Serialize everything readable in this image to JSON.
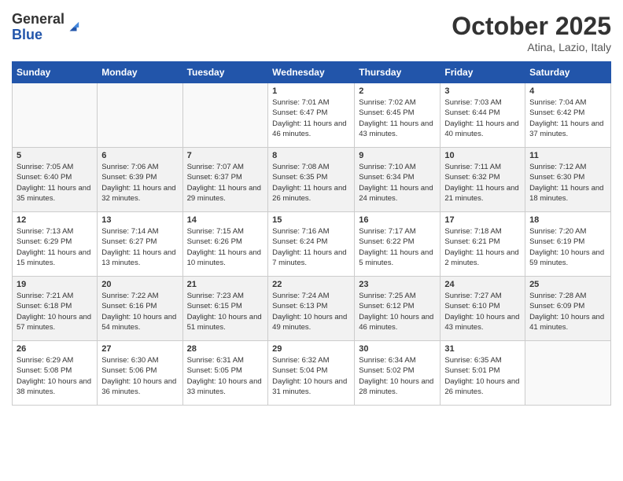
{
  "header": {
    "logo_general": "General",
    "logo_blue": "Blue",
    "month": "October 2025",
    "location": "Atina, Lazio, Italy"
  },
  "days_of_week": [
    "Sunday",
    "Monday",
    "Tuesday",
    "Wednesday",
    "Thursday",
    "Friday",
    "Saturday"
  ],
  "weeks": [
    [
      {
        "day": "",
        "info": ""
      },
      {
        "day": "",
        "info": ""
      },
      {
        "day": "",
        "info": ""
      },
      {
        "day": "1",
        "info": "Sunrise: 7:01 AM\nSunset: 6:47 PM\nDaylight: 11 hours and 46 minutes."
      },
      {
        "day": "2",
        "info": "Sunrise: 7:02 AM\nSunset: 6:45 PM\nDaylight: 11 hours and 43 minutes."
      },
      {
        "day": "3",
        "info": "Sunrise: 7:03 AM\nSunset: 6:44 PM\nDaylight: 11 hours and 40 minutes."
      },
      {
        "day": "4",
        "info": "Sunrise: 7:04 AM\nSunset: 6:42 PM\nDaylight: 11 hours and 37 minutes."
      }
    ],
    [
      {
        "day": "5",
        "info": "Sunrise: 7:05 AM\nSunset: 6:40 PM\nDaylight: 11 hours and 35 minutes."
      },
      {
        "day": "6",
        "info": "Sunrise: 7:06 AM\nSunset: 6:39 PM\nDaylight: 11 hours and 32 minutes."
      },
      {
        "day": "7",
        "info": "Sunrise: 7:07 AM\nSunset: 6:37 PM\nDaylight: 11 hours and 29 minutes."
      },
      {
        "day": "8",
        "info": "Sunrise: 7:08 AM\nSunset: 6:35 PM\nDaylight: 11 hours and 26 minutes."
      },
      {
        "day": "9",
        "info": "Sunrise: 7:10 AM\nSunset: 6:34 PM\nDaylight: 11 hours and 24 minutes."
      },
      {
        "day": "10",
        "info": "Sunrise: 7:11 AM\nSunset: 6:32 PM\nDaylight: 11 hours and 21 minutes."
      },
      {
        "day": "11",
        "info": "Sunrise: 7:12 AM\nSunset: 6:30 PM\nDaylight: 11 hours and 18 minutes."
      }
    ],
    [
      {
        "day": "12",
        "info": "Sunrise: 7:13 AM\nSunset: 6:29 PM\nDaylight: 11 hours and 15 minutes."
      },
      {
        "day": "13",
        "info": "Sunrise: 7:14 AM\nSunset: 6:27 PM\nDaylight: 11 hours and 13 minutes."
      },
      {
        "day": "14",
        "info": "Sunrise: 7:15 AM\nSunset: 6:26 PM\nDaylight: 11 hours and 10 minutes."
      },
      {
        "day": "15",
        "info": "Sunrise: 7:16 AM\nSunset: 6:24 PM\nDaylight: 11 hours and 7 minutes."
      },
      {
        "day": "16",
        "info": "Sunrise: 7:17 AM\nSunset: 6:22 PM\nDaylight: 11 hours and 5 minutes."
      },
      {
        "day": "17",
        "info": "Sunrise: 7:18 AM\nSunset: 6:21 PM\nDaylight: 11 hours and 2 minutes."
      },
      {
        "day": "18",
        "info": "Sunrise: 7:20 AM\nSunset: 6:19 PM\nDaylight: 10 hours and 59 minutes."
      }
    ],
    [
      {
        "day": "19",
        "info": "Sunrise: 7:21 AM\nSunset: 6:18 PM\nDaylight: 10 hours and 57 minutes."
      },
      {
        "day": "20",
        "info": "Sunrise: 7:22 AM\nSunset: 6:16 PM\nDaylight: 10 hours and 54 minutes."
      },
      {
        "day": "21",
        "info": "Sunrise: 7:23 AM\nSunset: 6:15 PM\nDaylight: 10 hours and 51 minutes."
      },
      {
        "day": "22",
        "info": "Sunrise: 7:24 AM\nSunset: 6:13 PM\nDaylight: 10 hours and 49 minutes."
      },
      {
        "day": "23",
        "info": "Sunrise: 7:25 AM\nSunset: 6:12 PM\nDaylight: 10 hours and 46 minutes."
      },
      {
        "day": "24",
        "info": "Sunrise: 7:27 AM\nSunset: 6:10 PM\nDaylight: 10 hours and 43 minutes."
      },
      {
        "day": "25",
        "info": "Sunrise: 7:28 AM\nSunset: 6:09 PM\nDaylight: 10 hours and 41 minutes."
      }
    ],
    [
      {
        "day": "26",
        "info": "Sunrise: 6:29 AM\nSunset: 5:08 PM\nDaylight: 10 hours and 38 minutes."
      },
      {
        "day": "27",
        "info": "Sunrise: 6:30 AM\nSunset: 5:06 PM\nDaylight: 10 hours and 36 minutes."
      },
      {
        "day": "28",
        "info": "Sunrise: 6:31 AM\nSunset: 5:05 PM\nDaylight: 10 hours and 33 minutes."
      },
      {
        "day": "29",
        "info": "Sunrise: 6:32 AM\nSunset: 5:04 PM\nDaylight: 10 hours and 31 minutes."
      },
      {
        "day": "30",
        "info": "Sunrise: 6:34 AM\nSunset: 5:02 PM\nDaylight: 10 hours and 28 minutes."
      },
      {
        "day": "31",
        "info": "Sunrise: 6:35 AM\nSunset: 5:01 PM\nDaylight: 10 hours and 26 minutes."
      },
      {
        "day": "",
        "info": ""
      }
    ]
  ]
}
